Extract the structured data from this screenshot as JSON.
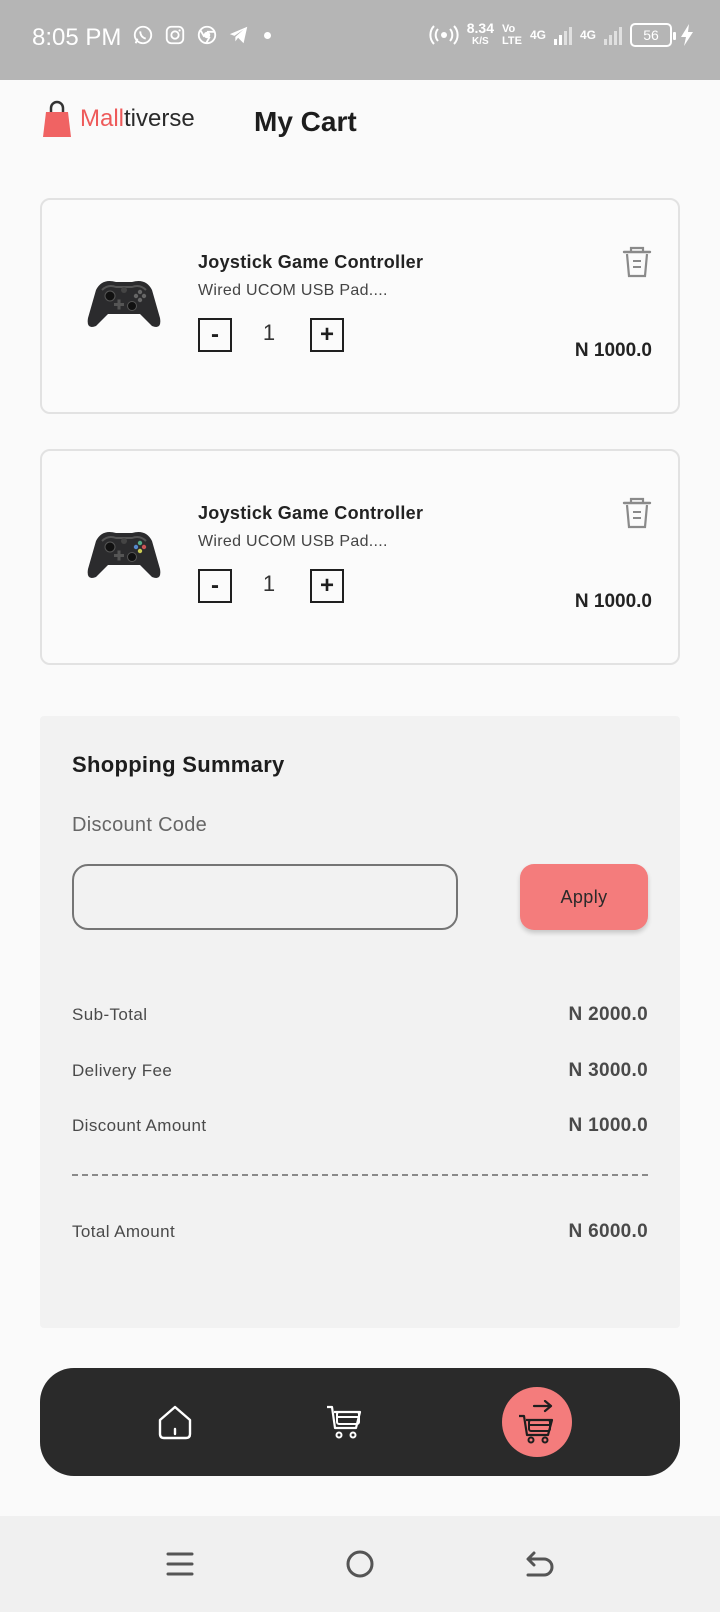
{
  "status_bar": {
    "time": "8:05 PM",
    "speed_value": "8.34",
    "speed_unit": "K/S",
    "net1_top": "Vo",
    "net1_bottom": "LTE",
    "net2": "4G",
    "net3": "4G",
    "battery": "56",
    "icons_left": [
      "whatsapp-icon",
      "instagram-icon",
      "chrome-icon",
      "telegram-icon"
    ]
  },
  "header": {
    "logo_part1": "Mall",
    "logo_part2": "tiverse",
    "title": "My Cart"
  },
  "cart": {
    "items": [
      {
        "name": "Joystick Game Controller",
        "description": "Wired UCOM USB Pad....",
        "quantity": "1",
        "minus": "-",
        "plus": "+",
        "price": "N 1000.0"
      },
      {
        "name": "Joystick Game Controller",
        "description": "Wired UCOM USB Pad....",
        "quantity": "1",
        "minus": "-",
        "plus": "+",
        "price": "N 1000.0"
      }
    ]
  },
  "summary": {
    "title": "Shopping Summary",
    "discount_label": "Discount Code",
    "discount_value": "",
    "apply_label": "Apply",
    "subtotal_label": "Sub-Total",
    "subtotal_value": "N 2000.0",
    "delivery_label": "Delivery Fee",
    "delivery_value": "N 3000.0",
    "discount_amount_label": "Discount Amount",
    "discount_amount_value": "N 1000.0",
    "total_label": "Total Amount",
    "total_value": "N 6000.0"
  },
  "bottom_nav": {
    "items": [
      "home-icon",
      "cart-icon",
      "checkout-icon"
    ],
    "active": "checkout-icon",
    "active_color": "#f47c7c",
    "bar_color": "#2a2a2a"
  },
  "colors": {
    "accent": "#f47c7c",
    "brand_red": "#ee5a5a"
  }
}
